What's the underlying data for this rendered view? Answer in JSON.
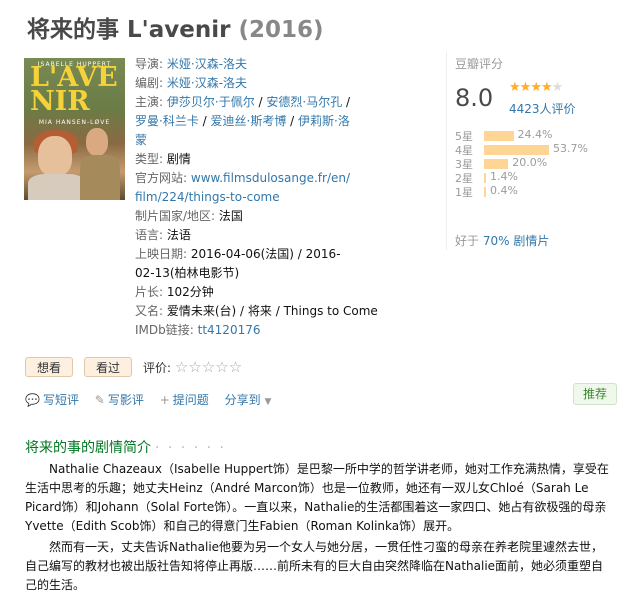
{
  "title": {
    "main": "将来的事 L'avenir",
    "year": "(2016)"
  },
  "poster": {
    "actor": "ISABELLE HUPPERT",
    "big_line1": "L'AVE",
    "big_line2": "NIR",
    "director": "MIA HANSEN-LØVE"
  },
  "info": {
    "director_label": "导演:",
    "director": "米娅·汉森-洛夫",
    "writer_label": "编剧:",
    "writer": "米娅·汉森-洛夫",
    "cast_label": "主演:",
    "cast": [
      "伊莎贝尔·于佩尔",
      "安德烈·马尔孔",
      "罗曼·科兰卡",
      "爱迪丝·斯考博",
      "伊莉斯·洛蒙"
    ],
    "genre_label": "类型:",
    "genre": "剧情",
    "site_label": "官方网站:",
    "site": "www.filmsdulosange.fr/en/film/224/things-to-come",
    "country_label": "制片国家/地区:",
    "country": "法国",
    "lang_label": "语言:",
    "lang": "法语",
    "date_label": "上映日期:",
    "date": "2016-04-06(法国) / 2016-02-13(柏林电影节)",
    "runtime_label": "片长:",
    "runtime": "102分钟",
    "aka_label": "又名:",
    "aka": "爱情未来(台) / 将来 / Things to Come",
    "imdb_label": "IMDb链接:",
    "imdb": "tt4120176"
  },
  "rating": {
    "header": "豆瓣评分",
    "score": "8.0",
    "stars": 4,
    "votes": "4423人评价",
    "dist": [
      {
        "label": "5星",
        "pct": "24.4%",
        "value": 24.4
      },
      {
        "label": "4星",
        "pct": "53.7%",
        "value": 53.7
      },
      {
        "label": "3星",
        "pct": "20.0%",
        "value": 20.0
      },
      {
        "label": "2星",
        "pct": "1.4%",
        "value": 1.4
      },
      {
        "label": "1星",
        "pct": "0.4%",
        "value": 0.4
      }
    ],
    "better_prefix": "好于",
    "better_link": "70% 剧情片"
  },
  "buttons": {
    "want": "想看",
    "seen": "看过",
    "rate_label": "评价:"
  },
  "actions": {
    "short": "写短评",
    "review": "写影评",
    "question": "提问题",
    "share": "分享到",
    "recommend": "推荐"
  },
  "intro": {
    "heading": "将来的事的剧情简介",
    "dots": "· · · · · ·",
    "p1": "Nathalie Chazeaux（Isabelle Huppert饰）是巴黎一所中学的哲学讲老师，她对工作充满热情，享受在生活中思考的乐趣；她丈夫Heinz（André Marcon饰）也是一位教师，她还有一双儿女Chloé（Sarah Le Picard饰）和Johann（Solal Forte饰）。一直以来，Nathalie的生活都围着这一家四口、她占有欲极强的母亲Yvette（Edith Scob饰）和自己的得意门生Fabien（Roman Kolinka饰）展开。",
    "p2": "然而有一天，丈夫告诉Nathalie他要为另一个女人与她分居，一贯任性刁蛮的母亲在养老院里遽然去世，自己编写的教材也被出版社告知将停止再版……前所未有的巨大自由突然降临在Nathalie面前，她必须重塑自己的生活。"
  },
  "colors": {
    "link": "#3377aa",
    "green_heading": "#007722",
    "star": "#ffac2d",
    "bar": "#ffd596"
  }
}
